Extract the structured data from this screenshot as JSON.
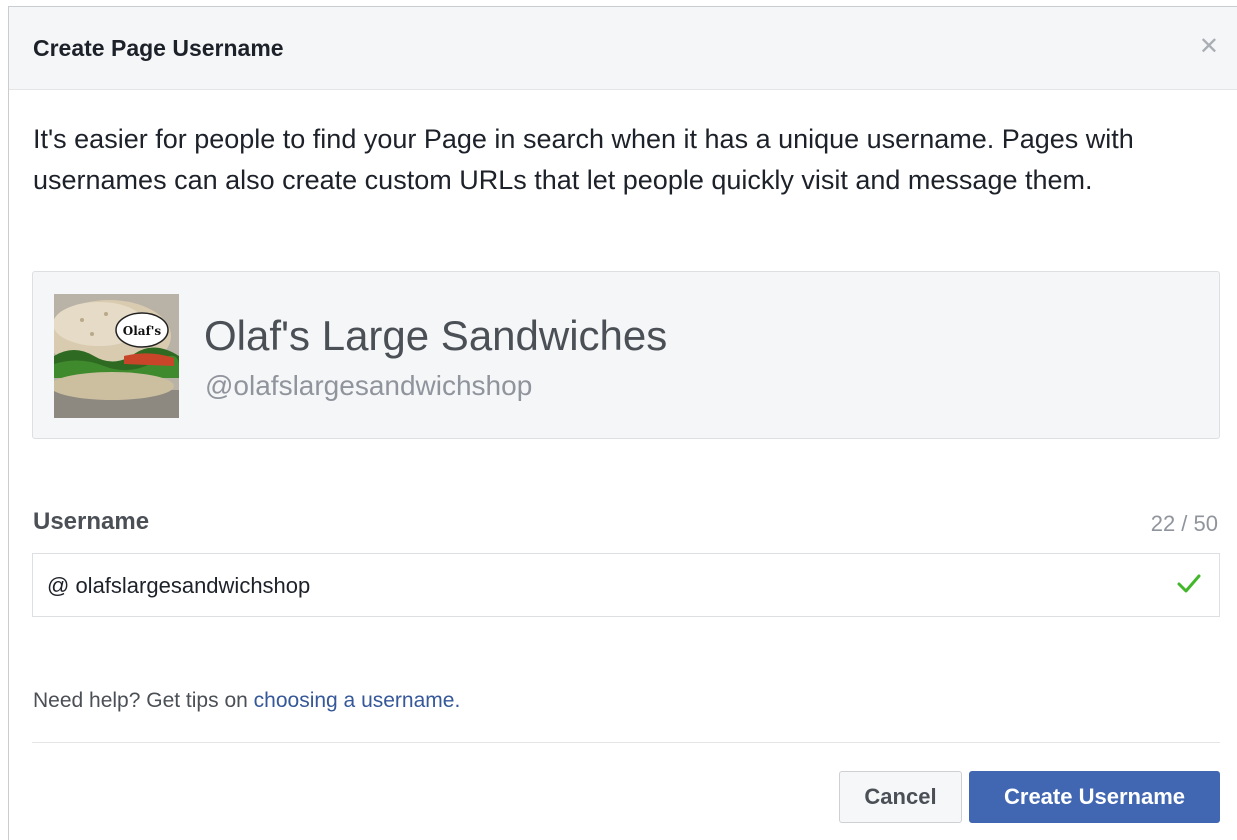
{
  "dialog": {
    "title": "Create Page Username",
    "close_icon": "close-icon"
  },
  "intro": "It's easier for people to find your Page in search when it has a unique username. Pages with usernames can also create custom URLs that let people quickly visit and message them.",
  "preview": {
    "avatar_label": "Olaf's",
    "page_name": "Olaf's Large Sandwiches",
    "page_handle": "@olafslargesandwichshop"
  },
  "username": {
    "label": "Username",
    "counter": "22 / 50",
    "value": "@ olafslargesandwichshop",
    "status_icon": "checkmark-icon"
  },
  "help": {
    "prefix": "Need help? Get tips on ",
    "link": "choosing a username."
  },
  "buttons": {
    "cancel": "Cancel",
    "create": "Create Username"
  },
  "colors": {
    "primary": "#4267b2",
    "link": "#365899",
    "success": "#42b72a"
  }
}
